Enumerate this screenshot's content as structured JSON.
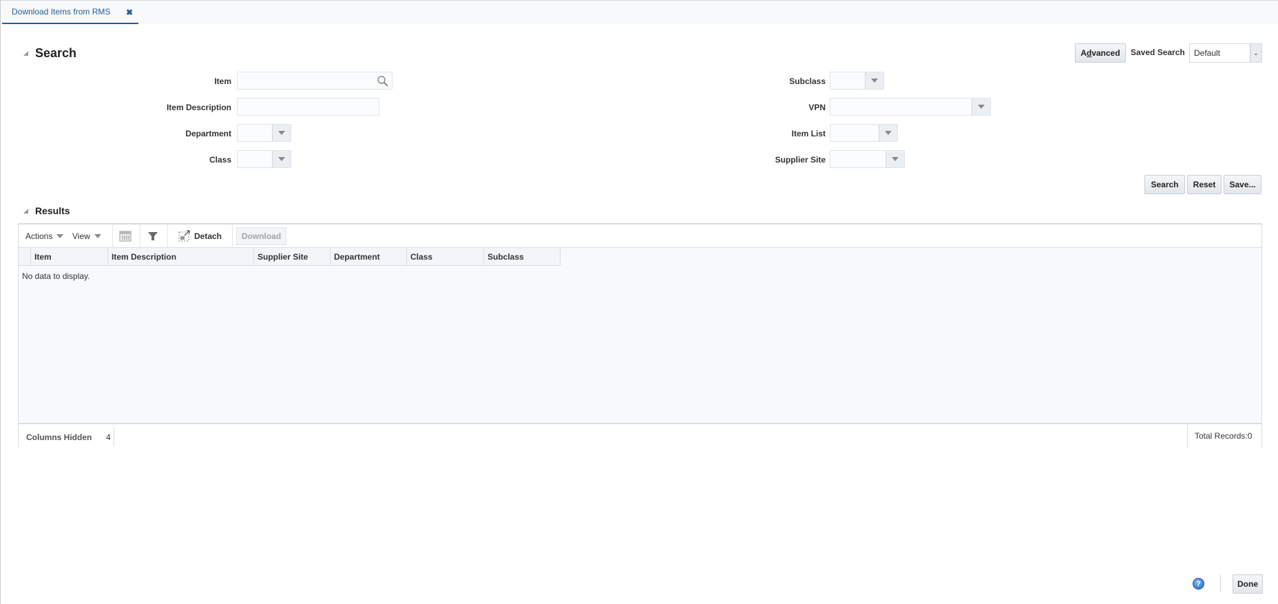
{
  "tab": {
    "title": "Download Items from RMS",
    "close_icon": "close-icon"
  },
  "search": {
    "title": "Search",
    "advanced_label": "Advanced",
    "saved_search_label": "Saved Search",
    "saved_search_value": "Default",
    "fields_left": [
      {
        "label": "Item",
        "type": "lov",
        "value": ""
      },
      {
        "label": "Item Description",
        "type": "text",
        "value": ""
      },
      {
        "label": "Department",
        "type": "select",
        "value": ""
      },
      {
        "label": "Class",
        "type": "select",
        "value": ""
      }
    ],
    "fields_right": [
      {
        "label": "Subclass",
        "type": "select",
        "value": ""
      },
      {
        "label": "VPN",
        "type": "select",
        "value": ""
      },
      {
        "label": "Item List",
        "type": "select",
        "value": ""
      },
      {
        "label": "Supplier Site",
        "type": "select",
        "value": ""
      }
    ],
    "buttons": {
      "search": "Search",
      "reset": "Reset",
      "save": "Save..."
    }
  },
  "results": {
    "title": "Results",
    "toolbar": {
      "actions": "Actions",
      "view": "View",
      "detach": "Detach",
      "download": "Download"
    },
    "columns": [
      "Item",
      "Item Description",
      "Supplier Site",
      "Department",
      "Class",
      "Subclass"
    ],
    "empty_message": "No data to display.",
    "columns_hidden_label": "Columns Hidden",
    "columns_hidden_count": "4",
    "total_records": "Total Records:0"
  },
  "footer": {
    "help_icon": "?",
    "done_label": "Done"
  }
}
